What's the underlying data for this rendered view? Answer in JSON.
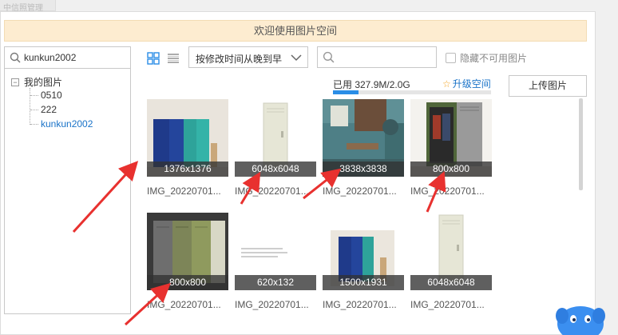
{
  "topstrip": {
    "label": "中信照管理"
  },
  "banner": {
    "text": "欢迎使用图片空间"
  },
  "left_search": {
    "value": "kunkun2002",
    "icon": "search-icon"
  },
  "tree": {
    "root": {
      "toggle": "−",
      "label": "我的图片"
    },
    "children": [
      {
        "label": "0510",
        "selected": false
      },
      {
        "label": "222",
        "selected": false
      },
      {
        "label": "kunkun2002",
        "selected": true
      }
    ]
  },
  "toolbar": {
    "grid_view_icon": "grid-view-icon",
    "list_view_icon": "list-view-icon",
    "sort_label": "按修改时间从晚到早",
    "search_placeholder": "",
    "hide_unavailable_label": "隐藏不可用图片"
  },
  "storage": {
    "usage_text": "已用 327.9M/2.0G",
    "used_fraction": 0.16,
    "upgrade_label": "升级空间",
    "upload_label": "上传图片"
  },
  "images": [
    {
      "dims": "1376x1376",
      "name": "IMG_20220701...",
      "art": "blue-teal-lockers"
    },
    {
      "dims": "6048x6048",
      "name": "IMG_20220701...",
      "art": "cream-locker"
    },
    {
      "dims": "3838x3838",
      "name": "IMG_20220701...",
      "art": "locker-room"
    },
    {
      "dims": "800x800",
      "name": "IMG_20220701...",
      "art": "open-locker"
    },
    {
      "dims": "800x800",
      "name": "IMG_20220701...",
      "art": "gray-green-lockers"
    },
    {
      "dims": "620x132",
      "name": "IMG_20220701...",
      "art": "text-banner"
    },
    {
      "dims": "1500x1931",
      "name": "IMG_20220701...",
      "art": "blue-teal-lockers-small"
    },
    {
      "dims": "6048x6048",
      "name": "IMG_20220701...",
      "art": "cream-locker-2"
    }
  ],
  "colors": {
    "accent": "#1a73c8",
    "banner_bg": "#fdecd0",
    "arrow": "#e8312f",
    "progress": "#2a8de6"
  }
}
